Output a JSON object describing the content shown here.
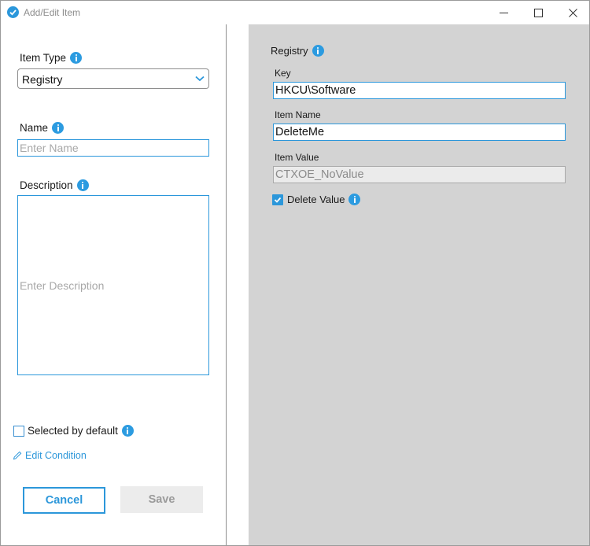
{
  "window": {
    "title": "Add/Edit Item",
    "accent_color": "#2b97db"
  },
  "left": {
    "item_type": {
      "label": "Item Type",
      "selected": "Registry"
    },
    "name": {
      "label": "Name",
      "placeholder": "Enter Name",
      "value": ""
    },
    "description": {
      "label": "Description",
      "placeholder": "Enter Description",
      "value": ""
    },
    "selected_by_default": {
      "label": "Selected by default",
      "checked": false
    },
    "edit_condition": {
      "label": "Edit Condition"
    },
    "cancel_label": "Cancel",
    "save_label": "Save"
  },
  "right": {
    "section_title": "Registry",
    "key": {
      "label": "Key",
      "value": "HKCU\\Software"
    },
    "item_name": {
      "label": "Item Name",
      "value": "DeleteMe"
    },
    "item_value": {
      "label": "Item Value",
      "value": "CTXOE_NoValue",
      "disabled": true
    },
    "delete_value": {
      "label": "Delete Value",
      "checked": true
    }
  },
  "icons": [
    "check-circle-icon",
    "minimize-icon",
    "maximize-icon",
    "close-icon",
    "info-icon",
    "chevron-down-icon",
    "pencil-icon",
    "checkmark-icon"
  ]
}
